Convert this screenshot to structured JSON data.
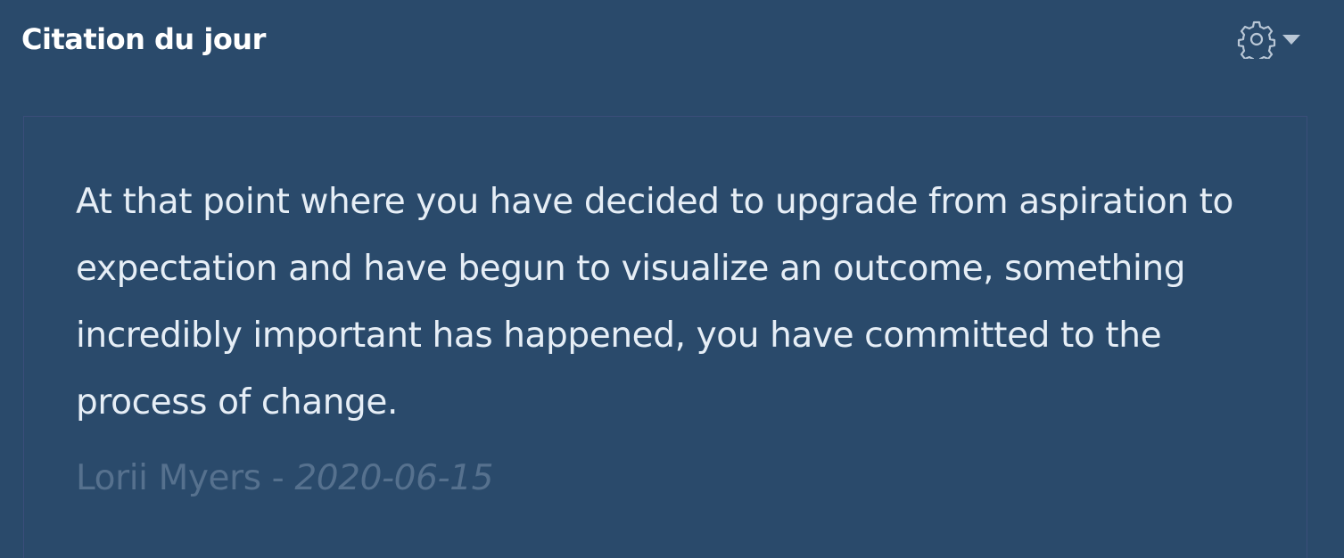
{
  "widget": {
    "title": "Citation du jour",
    "settings_icon": "gear-icon",
    "dropdown_icon": "caret-down-icon"
  },
  "quote": {
    "text": "At that point where you have decided to upgrade from aspiration to expectation and have begun to visualize an outcome, something incredibly important has happened, you have committed to the process of change.",
    "author": "Lorii Myers",
    "separator": " - ",
    "date": "2020-06-15"
  },
  "colors": {
    "background": "#2a4a6b",
    "title": "#ffffff",
    "quote_text": "#e6eef6",
    "source_text": "#56718e",
    "panel_border": "#3b4e7a"
  }
}
